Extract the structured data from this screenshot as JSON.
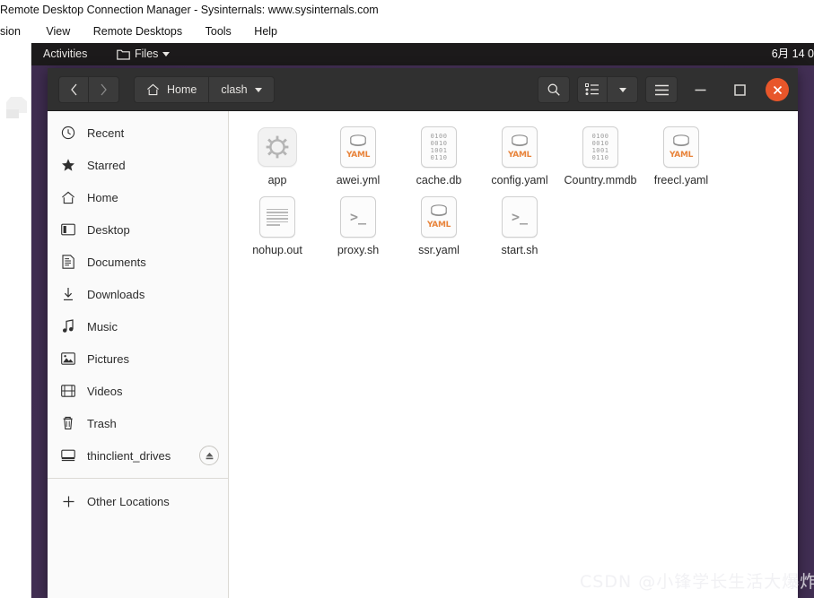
{
  "host_window": {
    "title": "Remote Desktop Connection Manager - Sysinternals: www.sysinternals.com",
    "menu": [
      {
        "label": "sion"
      },
      {
        "label": "View"
      },
      {
        "label": "Remote Desktops"
      },
      {
        "label": "Tools"
      },
      {
        "label": "Help"
      }
    ]
  },
  "topbar": {
    "activities": "Activities",
    "app_name": "Files",
    "app_icon": "folder-icon",
    "app_caret": "chevron-down-icon",
    "clock": "6月 14 0"
  },
  "headerbar": {
    "back_icon": "chevron-left-icon",
    "forward_icon": "chevron-right-icon",
    "home_icon": "home-icon",
    "home_label": "Home",
    "current_label": "clash",
    "path_caret": "chevron-down-icon",
    "search_icon": "search-icon",
    "view_list_icon": "list-view-icon",
    "view_caret": "chevron-down-icon",
    "menu_icon": "hamburger-menu-icon",
    "minimize_icon": "minimize-icon",
    "maximize_icon": "maximize-icon",
    "close_icon": "close-icon",
    "close_color": "#e8562a"
  },
  "sidebar": {
    "items": [
      {
        "label": "Recent",
        "icon": "clock-icon"
      },
      {
        "label": "Starred",
        "icon": "star-icon"
      },
      {
        "label": "Home",
        "icon": "home-icon"
      },
      {
        "label": "Desktop",
        "icon": "desktop-icon"
      },
      {
        "label": "Documents",
        "icon": "documents-icon"
      },
      {
        "label": "Downloads",
        "icon": "download-icon"
      },
      {
        "label": "Music",
        "icon": "music-note-icon"
      },
      {
        "label": "Pictures",
        "icon": "picture-icon"
      },
      {
        "label": "Videos",
        "icon": "video-icon"
      },
      {
        "label": "Trash",
        "icon": "trash-icon"
      },
      {
        "label": "thinclient_drives",
        "icon": "drive-icon",
        "eject": "eject-icon"
      }
    ],
    "other_locations": {
      "label": "Other Locations",
      "icon": "plus-icon"
    }
  },
  "files": [
    {
      "name": "app",
      "icon": "gear-app-icon"
    },
    {
      "name": "awei.yml",
      "icon": "yaml-icon"
    },
    {
      "name": "cache.db",
      "icon": "binary-db-icon"
    },
    {
      "name": "config.yaml",
      "icon": "yaml-icon"
    },
    {
      "name": "Country.mmdb",
      "icon": "binary-db-icon"
    },
    {
      "name": "freecl.yaml",
      "icon": "yaml-icon"
    },
    {
      "name": "nohup.out",
      "icon": "text-file-icon"
    },
    {
      "name": "proxy.sh",
      "icon": "shell-script-icon"
    },
    {
      "name": "ssr.yaml",
      "icon": "yaml-icon"
    },
    {
      "name": "start.sh",
      "icon": "shell-script-icon"
    }
  ],
  "watermark": "CSDN @小锋学长生活大爆炸"
}
